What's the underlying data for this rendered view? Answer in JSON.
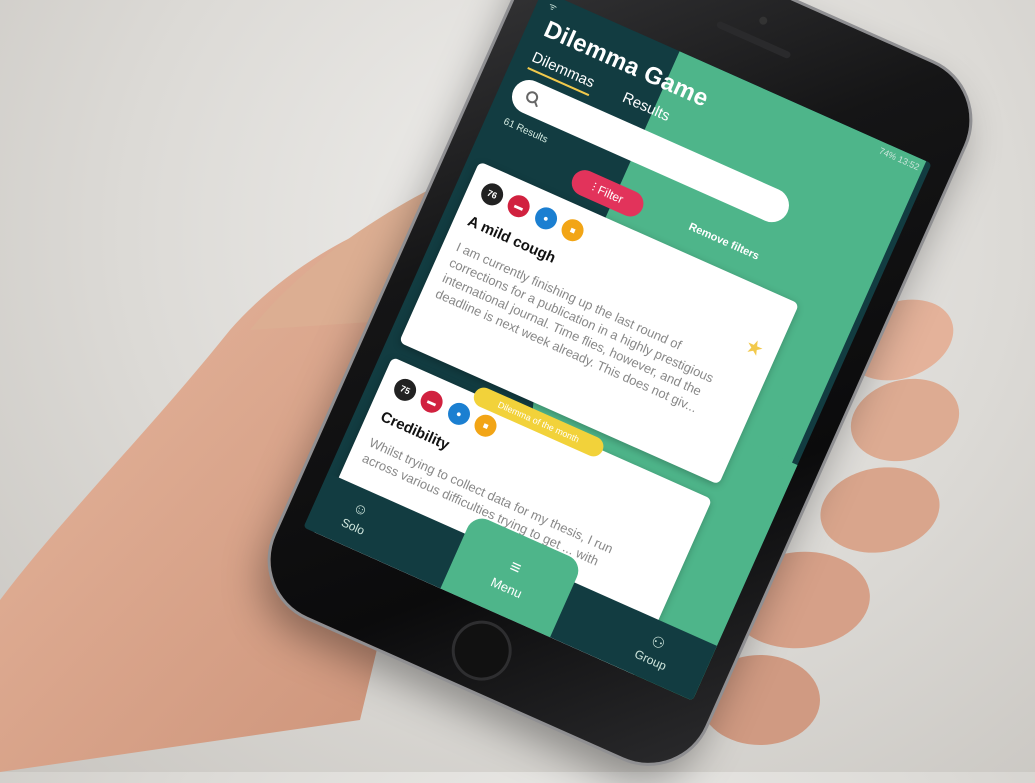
{
  "status": {
    "left": "ᯤ",
    "right": "74% 13:52"
  },
  "app": {
    "title": "Dilemma Game"
  },
  "tabs": [
    {
      "label": "Dilemmas",
      "active": true
    },
    {
      "label": "Results",
      "active": false
    }
  ],
  "search": {
    "value": "",
    "placeholder": ""
  },
  "results_count": "61 Results",
  "filter": {
    "label": "Filter",
    "icon": "filter-icon"
  },
  "remove_filters": "Remove filters",
  "cards": [
    {
      "badge_number": "76",
      "title": "A mild cough",
      "body": "I am currently finishing up the last round of corrections for a publication in a highly prestigious international journal. Time flies, however, and the deadline is next week already. This does not giv...",
      "favorite": true
    },
    {
      "badge_number": "75",
      "title": "Credibility",
      "label": "Dilemma of the month",
      "body": "Whilst trying to collect data for my thesis, I run across various difficulties trying to get ... with"
    }
  ],
  "nav": {
    "solo": "Solo",
    "menu": "Menu",
    "group": "Group"
  },
  "colors": {
    "dark_teal": "#123c41",
    "green": "#4eb58a",
    "filter_red": "#e2335b",
    "accent_yellow": "#f2c94c"
  }
}
